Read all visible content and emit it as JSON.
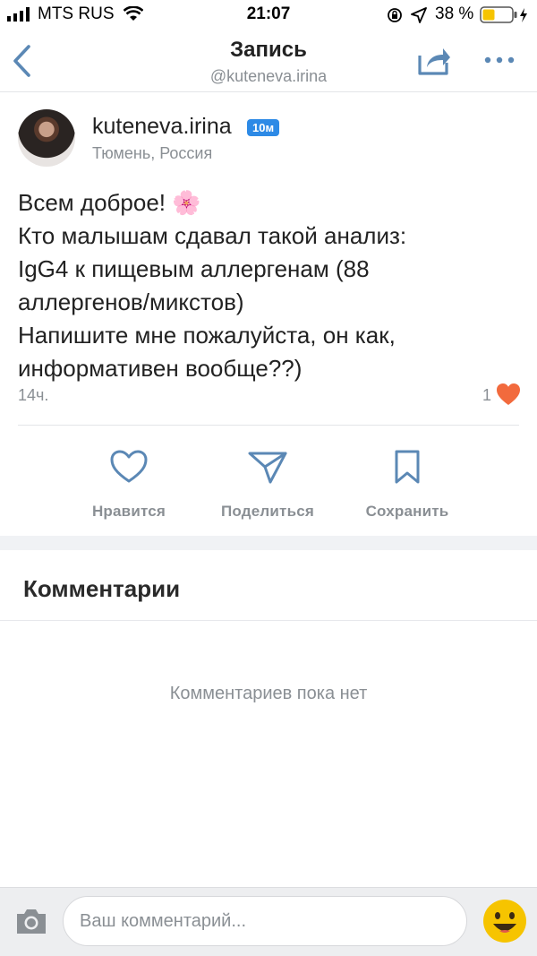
{
  "status_bar": {
    "carrier": "MTS RUS",
    "time": "21:07",
    "battery": "38 %"
  },
  "header": {
    "title": "Запись",
    "subtitle": "@kuteneva.irina",
    "back_icon": "chevron-left-icon",
    "share_icon": "share-icon",
    "more_icon": "more-horizontal-icon"
  },
  "post": {
    "author": "kuteneva.irina",
    "badge": "10м",
    "location": "Тюмень, Россия",
    "text_lines": [
      "Всем доброе! 🌸",
      "Кто малышам сдавал такой анализ:",
      "IgG4 к пищевым аллергенам (88",
      "аллергенов/микстов)",
      "Напишите мне пожалуйста, он как,",
      "информативен вообще??)"
    ],
    "time": "14ч.",
    "likes": "1"
  },
  "actions": {
    "like": "Нравится",
    "share": "Поделиться",
    "save": "Сохранить"
  },
  "comments": {
    "title": "Комментарии",
    "empty": "Комментариев пока нет"
  },
  "composer": {
    "placeholder": "Ваш комментарий..."
  },
  "colors": {
    "accent_blue": "#2d8ae6",
    "heart_orange": "#f26a3d",
    "muted": "#8a8f94",
    "icon_blue": "#5b88b5",
    "emoji_yellow": "#f6c400"
  }
}
